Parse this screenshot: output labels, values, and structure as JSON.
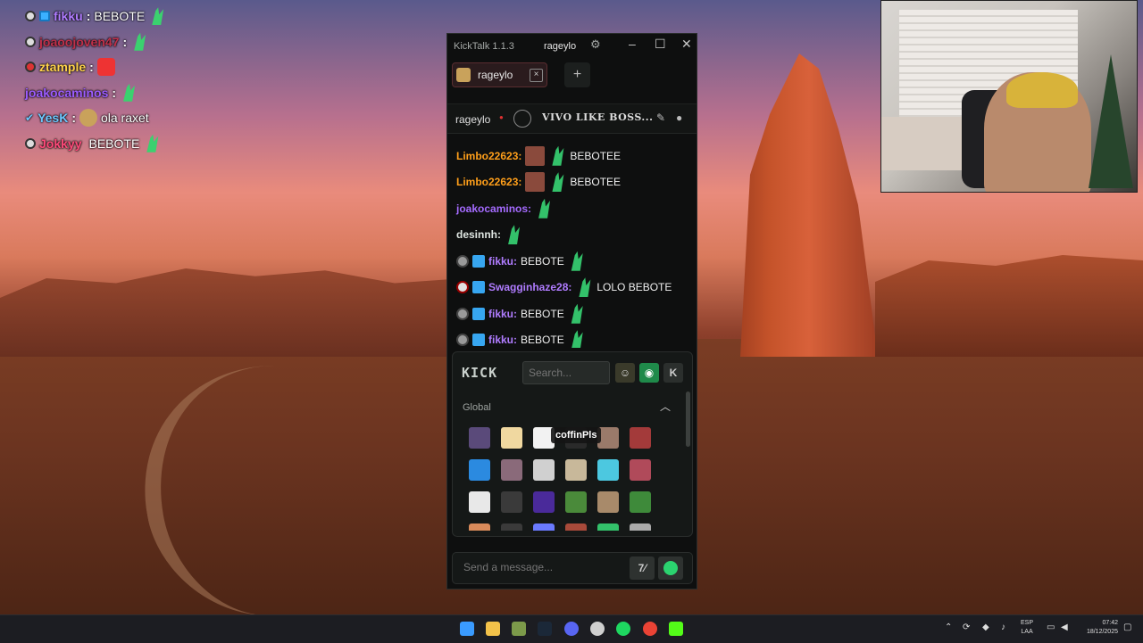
{
  "overlay_chat": [
    {
      "user": "fikku",
      "user_color": "#b07cff",
      "sep": ": ",
      "message": "BEBOTE"
    },
    {
      "user": "joaoojoven47",
      "user_color": "#c0304a",
      "sep": ": ",
      "message": ""
    },
    {
      "user": "ztample",
      "user_color": "#ffd24a",
      "sep": ": ",
      "message": ""
    },
    {
      "user": "joakocaminos",
      "user_color": "#9c5cff",
      "sep": ": ",
      "message": ""
    },
    {
      "user": "YesK",
      "user_color": "#6cc8ff",
      "sep": ": ",
      "message": "ola raxet"
    },
    {
      "user": "Jokkyy",
      "user_color": "#ff4a7a",
      "sep": " ",
      "message": "BEBOTE"
    }
  ],
  "app": {
    "title": "KickTalk 1.1.3",
    "username": "rageylo",
    "tab": {
      "label": "rageylo"
    },
    "channel": {
      "name": "rageylo",
      "stream_title": "VIVO LIKE BOSS..."
    },
    "messages": [
      {
        "user": "Limbo22623:",
        "color": "#ff9f1a",
        "text": "BEBOTEE",
        "badges": 0,
        "img": true
      },
      {
        "user": "Limbo22623:",
        "color": "#ff9f1a",
        "text": "BEBOTEE",
        "badges": 0,
        "img": true
      },
      {
        "user": "joakocaminos:",
        "color": "#a56bff",
        "text": "",
        "badges": 0,
        "img": false
      },
      {
        "user": "desinnh:",
        "color": "#dfe6e2",
        "text": "",
        "badges": 0,
        "img": false
      },
      {
        "user": "fikku:",
        "color": "#b07cff",
        "text": "BEBOTE",
        "badges": 2,
        "img": false
      },
      {
        "user": "Swagginhaze28:",
        "color": "#b07cff",
        "text": "LOLO BEBOTE",
        "badges": 3,
        "img": false
      },
      {
        "user": "fikku:",
        "color": "#b07cff",
        "text": "BEBOTE",
        "badges": 2,
        "img": false
      },
      {
        "user": "fikku:",
        "color": "#b07cff",
        "text": "BEBOTE",
        "badges": 2,
        "img": false
      }
    ],
    "emote_picker": {
      "logo": "KICK",
      "search_placeholder": "Search...",
      "section": "Global",
      "tooltip": "coffinPls",
      "emote_colors": [
        "#5a4a7a",
        "#f0d8a0",
        "#f2f2f2",
        "#2a2a2a",
        "#9a7a6a",
        "#a33a3a",
        "#2b8ae0",
        "#8a6a7a",
        "#d0d0d0",
        "#c8b89a",
        "#4cc8e0",
        "#b04a5a",
        "#e8e8e8",
        "#3a3a3a",
        "#4a2a9a",
        "#4a8a3a",
        "#a88a6a",
        "#3e8a3a",
        "#d88a5a",
        "#3a3a3a",
        "#6a7aff",
        "#a84a3a",
        "#33c16a",
        "#aaaaaa"
      ]
    },
    "composer": {
      "placeholder": "Send a message..."
    }
  },
  "taskbar": {
    "lang": "ESP",
    "lang2": "LAA",
    "time": "07:42",
    "date": "18/12/2025"
  }
}
